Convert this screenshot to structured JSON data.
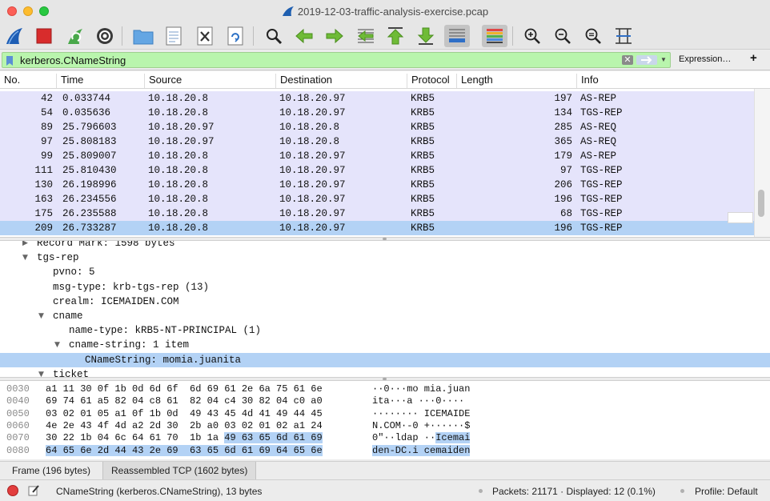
{
  "window": {
    "title": "2019-12-03-traffic-analysis-exercise.pcap"
  },
  "toolbar": {
    "icons": [
      "shark-fin-start-icon",
      "stop-square-icon",
      "restart-icon",
      "capture-options-gear-icon",
      "open-folder-icon",
      "file-properties-icon",
      "close-file-icon",
      "reload-icon",
      "find-magnifier-icon",
      "go-back-arrow-icon",
      "go-forward-arrow-icon",
      "go-to-packet-icon",
      "first-packet-icon",
      "last-packet-icon",
      "autoscroll-icon",
      "colorize-icon",
      "zoom-in-icon",
      "zoom-out-icon",
      "normal-size-icon",
      "resize-columns-icon"
    ]
  },
  "filter": {
    "value": "kerberos.CNameString",
    "expression_label": "Expression…",
    "add_label": "+",
    "clear_label": "✕",
    "background": "#b9f5ad"
  },
  "packet_list": {
    "columns": [
      "No.",
      "Time",
      "Source",
      "Destination",
      "Protocol",
      "Length",
      "Info"
    ],
    "rows": [
      {
        "no": "42",
        "time": "0.033744",
        "src": "10.18.20.8",
        "dst": "10.18.20.97",
        "proto": "KRB5",
        "len": "197",
        "info": "AS-REP"
      },
      {
        "no": "54",
        "time": "0.035636",
        "src": "10.18.20.8",
        "dst": "10.18.20.97",
        "proto": "KRB5",
        "len": "134",
        "info": "TGS-REP"
      },
      {
        "no": "89",
        "time": "25.796603",
        "src": "10.18.20.97",
        "dst": "10.18.20.8",
        "proto": "KRB5",
        "len": "285",
        "info": "AS-REQ"
      },
      {
        "no": "97",
        "time": "25.808183",
        "src": "10.18.20.97",
        "dst": "10.18.20.8",
        "proto": "KRB5",
        "len": "365",
        "info": "AS-REQ"
      },
      {
        "no": "99",
        "time": "25.809007",
        "src": "10.18.20.8",
        "dst": "10.18.20.97",
        "proto": "KRB5",
        "len": "179",
        "info": "AS-REP"
      },
      {
        "no": "111",
        "time": "25.810430",
        "src": "10.18.20.8",
        "dst": "10.18.20.97",
        "proto": "KRB5",
        "len": "97",
        "info": "TGS-REP"
      },
      {
        "no": "130",
        "time": "26.198996",
        "src": "10.18.20.8",
        "dst": "10.18.20.97",
        "proto": "KRB5",
        "len": "206",
        "info": "TGS-REP"
      },
      {
        "no": "163",
        "time": "26.234556",
        "src": "10.18.20.8",
        "dst": "10.18.20.97",
        "proto": "KRB5",
        "len": "196",
        "info": "TGS-REP"
      },
      {
        "no": "175",
        "time": "26.235588",
        "src": "10.18.20.8",
        "dst": "10.18.20.97",
        "proto": "KRB5",
        "len": "68",
        "info": "TGS-REP"
      },
      {
        "no": "209",
        "time": "26.733287",
        "src": "10.18.20.8",
        "dst": "10.18.20.97",
        "proto": "KRB5",
        "len": "196",
        "info": "TGS-REP"
      }
    ],
    "selected_no": "209",
    "row_color": "#e5e4fb",
    "selected_color": "#b3d2f5"
  },
  "details": {
    "rows": [
      {
        "text": "Record Mark: 1598 bytes",
        "expander": "▶",
        "level": 1
      },
      {
        "text": "tgs-rep",
        "expander": "▼",
        "level": 1
      },
      {
        "text": "pvno: 5",
        "expander": "",
        "level": 2
      },
      {
        "text": "msg-type: krb-tgs-rep (13)",
        "expander": "",
        "level": 2
      },
      {
        "text": "crealm: ICEMAIDEN.COM",
        "expander": "",
        "level": 2
      },
      {
        "text": "cname",
        "expander": "▼",
        "level": 2
      },
      {
        "text": "name-type: kRB5-NT-PRINCIPAL (1)",
        "expander": "",
        "level": 3
      },
      {
        "text": "cname-string: 1 item",
        "expander": "▼",
        "level": 3
      },
      {
        "text": "CNameString: momia.juanita",
        "expander": "",
        "level": 4
      },
      {
        "text": "ticket",
        "expander": "▼",
        "level": 2
      }
    ]
  },
  "hex": {
    "rows": [
      {
        "offset": "0030",
        "pre": "a1 11 30 0f 1b 0d 6d 6f  6d 69 61 2e 6a 75 61 6e",
        "hl": "",
        "ascii_pre": "··0···mo mia.juan",
        "ascii_hl": ""
      },
      {
        "offset": "0040",
        "pre": "69 74 61 a5 82 04 c8 61  82 04 c4 30 82 04 c0 a0",
        "hl": "",
        "ascii_pre": "ita···a ···0····",
        "ascii_hl": ""
      },
      {
        "offset": "0050",
        "pre": "03 02 01 05 a1 0f 1b 0d  49 43 45 4d 41 49 44 45",
        "hl": "",
        "ascii_pre": "········ ICEMAIDE",
        "ascii_hl": ""
      },
      {
        "offset": "0060",
        "pre": "4e 2e 43 4f 4d a2 2d 30  2b a0 03 02 01 02 a1 24",
        "hl": "",
        "ascii_pre": "N.COM·-0 +······$",
        "ascii_hl": ""
      },
      {
        "offset": "0070",
        "pre": "30 22 1b 04 6c 64 61 70  1b 1a ",
        "hl": "49 63 65 6d 61 69",
        "ascii_pre": "0\"··ldap ··",
        "ascii_hl": "Icemai"
      },
      {
        "offset": "0080",
        "pre": "",
        "hl": "64 65 6e 2d 44 43 2e 69  63 65 6d 61 69 64 65 6e",
        "ascii_pre": "",
        "ascii_hl": "den-DC.i cemaiden"
      }
    ]
  },
  "bottom_tabs": {
    "frame": "Frame (196 bytes)",
    "reassembled": "Reassembled TCP (1602 bytes)"
  },
  "status": {
    "field": "CNameString (kerberos.CNameString), 13 bytes",
    "packets": "Packets: 21171 · Displayed: 12 (0.1%)",
    "profile": "Profile: Default"
  }
}
